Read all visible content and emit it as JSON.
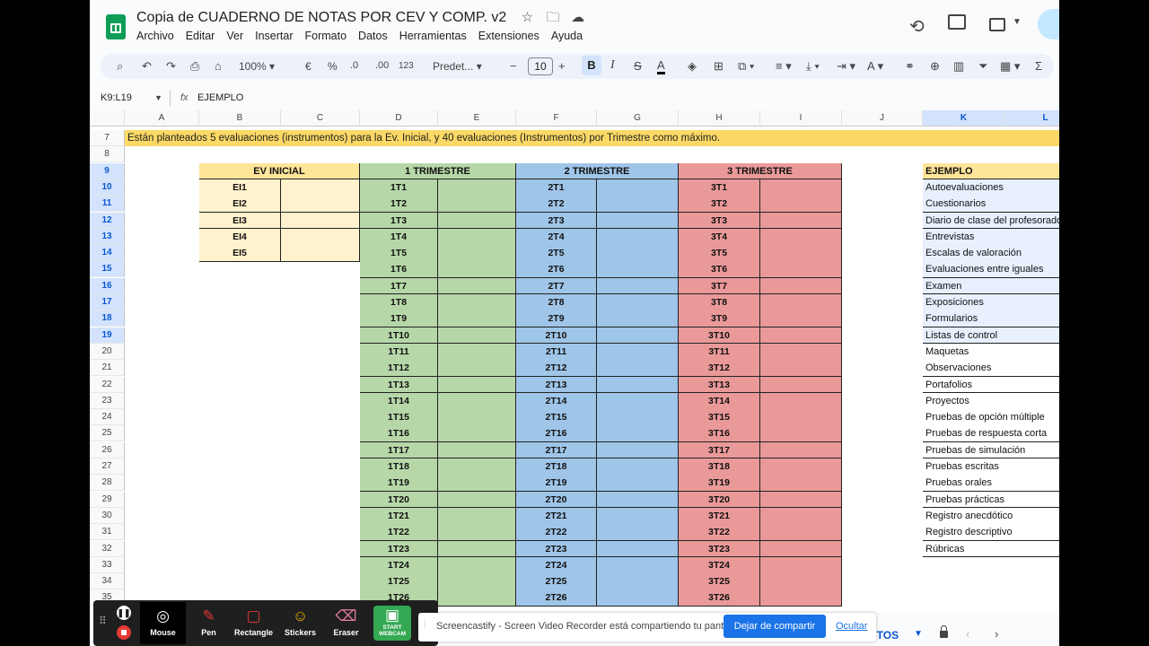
{
  "doc": {
    "title": "Copia de CUADERNO DE NOTAS POR CEV Y COMP. v2",
    "menu": [
      "Archivo",
      "Editar",
      "Ver",
      "Insertar",
      "Formato",
      "Datos",
      "Herramientas",
      "Extensiones",
      "Ayuda"
    ]
  },
  "toolbar": {
    "zoom": "100%",
    "currency": "€",
    "percent": "%",
    "dec_decrease": ".0",
    "dec_increase": ".00",
    "number_format": "123",
    "font": "Predet...",
    "font_size": "10",
    "bold": "B",
    "italic": "I",
    "strike": "S",
    "text_color": "A",
    "sum": "Σ"
  },
  "formula_bar": {
    "name_box": "K9:L19",
    "fx": "fx",
    "content": "EJEMPLO"
  },
  "columns": [
    "A",
    "B",
    "C",
    "D",
    "E",
    "F",
    "G",
    "H",
    "I",
    "J",
    "K",
    "L"
  ],
  "rows": [
    "7",
    "8",
    "9",
    "10",
    "11",
    "12",
    "13",
    "14",
    "15",
    "16",
    "17",
    "18",
    "19",
    "20",
    "21",
    "22",
    "23",
    "24",
    "25",
    "26",
    "27",
    "28",
    "29",
    "30",
    "31",
    "32",
    "33",
    "34",
    "35"
  ],
  "banner": "Están planteados 5 evaluaciones (instrumentos) para la Ev. Inicial, y 40 evaluaciones (Instrumentos) por Trimestre como máximo.",
  "headers": {
    "ev_inicial": "EV INICIAL",
    "t1": "1 TRIMESTRE",
    "t2": "2 TRIMESTRE",
    "t3": "3 TRIMESTRE",
    "ejemplo": "EJEMPLO"
  },
  "ev_inicial": [
    "EI1",
    "EI2",
    "EI3",
    "EI4",
    "EI5"
  ],
  "trimestre_1": [
    "1T1",
    "1T2",
    "1T3",
    "1T4",
    "1T5",
    "1T6",
    "1T7",
    "1T8",
    "1T9",
    "1T10",
    "1T11",
    "1T12",
    "1T13",
    "1T14",
    "1T15",
    "1T16",
    "1T17",
    "1T18",
    "1T19",
    "1T20",
    "1T21",
    "1T22",
    "1T23",
    "1T24",
    "1T25",
    "1T26"
  ],
  "trimestre_2": [
    "2T1",
    "2T2",
    "2T3",
    "2T4",
    "2T5",
    "2T6",
    "2T7",
    "2T8",
    "2T9",
    "2T10",
    "2T11",
    "2T12",
    "2T13",
    "2T14",
    "2T15",
    "2T16",
    "2T17",
    "2T18",
    "2T19",
    "2T20",
    "2T21",
    "2T22",
    "2T23",
    "2T24",
    "2T25",
    "2T26"
  ],
  "trimestre_3": [
    "3T1",
    "3T2",
    "3T3",
    "3T4",
    "3T5",
    "3T6",
    "3T7",
    "3T8",
    "3T9",
    "3T10",
    "3T11",
    "3T12",
    "3T13",
    "3T14",
    "3T15",
    "3T16",
    "3T17",
    "3T18",
    "3T19",
    "3T20",
    "3T21",
    "3T22",
    "3T23",
    "3T24",
    "3T25",
    "3T26"
  ],
  "ejemplo": [
    "Autoevaluaciones",
    "Cuestionarios",
    "Diario de clase del profesorado",
    "Entrevistas",
    "Escalas de valoración",
    "Evaluaciones entre iguales",
    "Examen",
    "Exposiciones",
    "Formularios",
    "Listas de control",
    "Maquetas",
    "Observaciones",
    "Portafolios",
    "Proyectos",
    "Pruebas de opción múltiple",
    "Pruebas de respuesta corta",
    "Pruebas de simulación",
    "Pruebas escritas",
    "Pruebas orales",
    "Pruebas prácticas",
    "Registro anecdótico",
    "Registro descriptivo",
    "Rúbricas"
  ],
  "colors": {
    "ev_inicial": "#fff2cc",
    "ev_inicial_header": "#ffe599",
    "t1": "#b6d7a8",
    "t2": "#9fc5e8",
    "t3": "#ea9999",
    "banner": "#fcd966",
    "ejemplo_header": "#ffe599",
    "ejemplo_sel": "#e8f0fe",
    "accent": "#0b57d0"
  },
  "sheet_tab": {
    "label": "NTOS"
  },
  "castify": {
    "tools": [
      {
        "label": "Mouse",
        "icon": "mouse-icon"
      },
      {
        "label": "Pen",
        "icon": "pen-icon"
      },
      {
        "label": "Rectangle",
        "icon": "rectangle-icon"
      },
      {
        "label": "Stickers",
        "icon": "sticker-icon"
      },
      {
        "label": "Eraser",
        "icon": "eraser-icon"
      },
      {
        "label": "START WEBCAM",
        "icon": "webcam-icon"
      }
    ],
    "notification": "Screencastify - Screen Video Recorder está compartiendo tu pantalla.",
    "stop_button": "Dejar de compartir",
    "hide_link": "Ocultar"
  }
}
